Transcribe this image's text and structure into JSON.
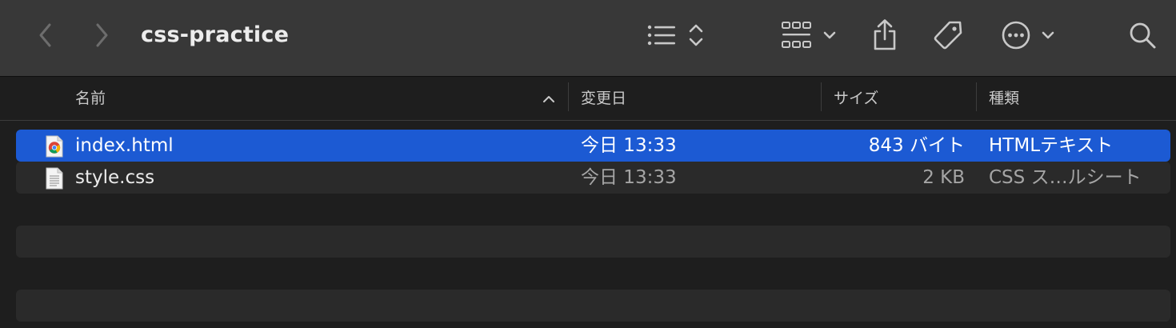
{
  "window": {
    "title": "css-practice"
  },
  "toolbar": {
    "back_icon": "chevron-left-icon",
    "forward_icon": "chevron-right-icon",
    "list_view_icon": "list-view-icon",
    "sort_icon": "up-down-chevron-icon",
    "group_icon": "grid-group-icon",
    "share_icon": "share-icon",
    "tag_icon": "tag-icon",
    "more_icon": "ellipsis-circle-icon",
    "search_icon": "search-icon"
  },
  "columns": {
    "name": "名前",
    "date": "変更日",
    "size": "サイズ",
    "kind": "種類"
  },
  "files": [
    {
      "name": "index.html",
      "date": "今日 13:33",
      "size": "843 バイト",
      "kind": "HTMLテキスト",
      "icon": "chrome-document-icon",
      "selected": true
    },
    {
      "name": "style.css",
      "date": "今日 13:33",
      "size": "2 KB",
      "kind": "CSS ス…ルシート",
      "icon": "text-document-icon",
      "selected": false
    }
  ],
  "colors": {
    "selection": "#1c5ad3",
    "toolbar": "#383838",
    "background": "#1e1e1e",
    "stripe": "#2a2a2a"
  }
}
